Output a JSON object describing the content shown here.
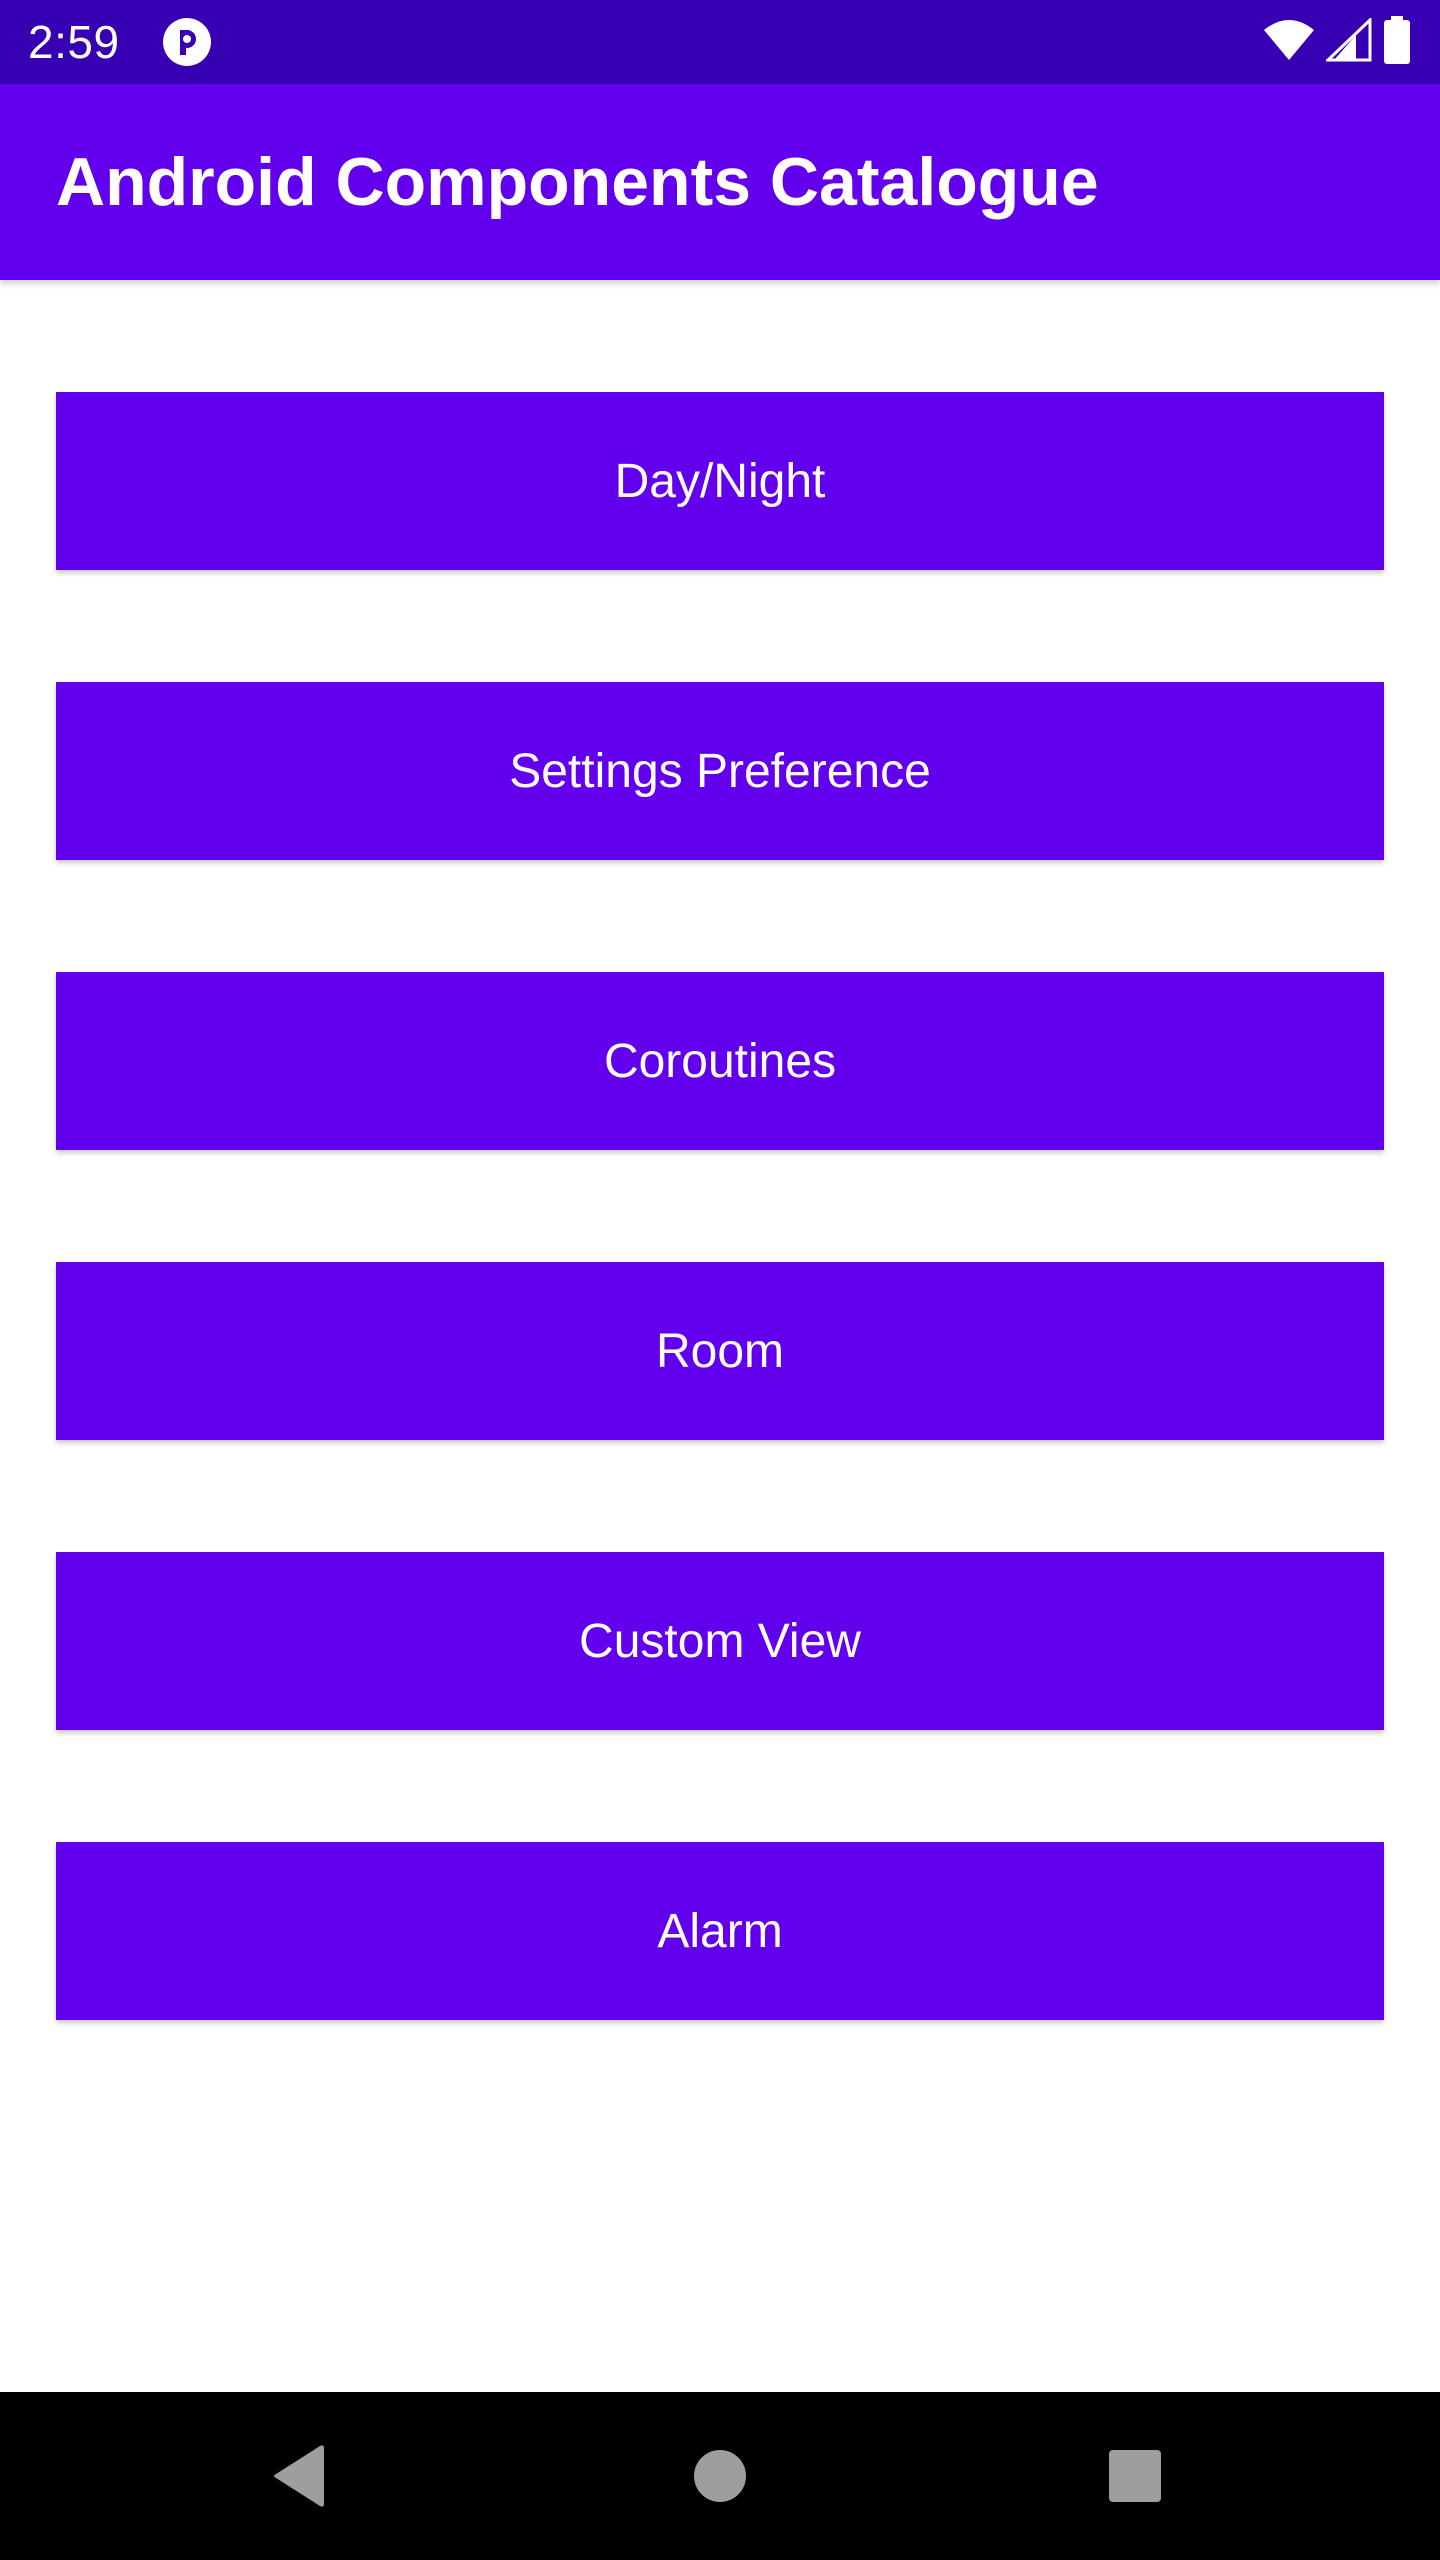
{
  "status_bar": {
    "time": "2:59",
    "icons": [
      "app-notification-icon",
      "wifi-icon",
      "cellular-signal-icon",
      "battery-icon"
    ]
  },
  "app_bar": {
    "title": "Android Components Catalogue"
  },
  "buttons": [
    {
      "label": "Day/Night"
    },
    {
      "label": "Settings Preference"
    },
    {
      "label": "Coroutines"
    },
    {
      "label": "Room"
    },
    {
      "label": "Custom View"
    },
    {
      "label": "Alarm"
    }
  ],
  "nav_bar": {
    "icons": [
      "back-icon",
      "home-icon",
      "recents-icon"
    ]
  },
  "colors": {
    "status_bar": "#3700b3",
    "primary": "#6200ee",
    "on_primary": "#ffffff",
    "background": "#ffffff",
    "nav_bar": "#000000",
    "nav_icon": "#9e9e9e"
  }
}
